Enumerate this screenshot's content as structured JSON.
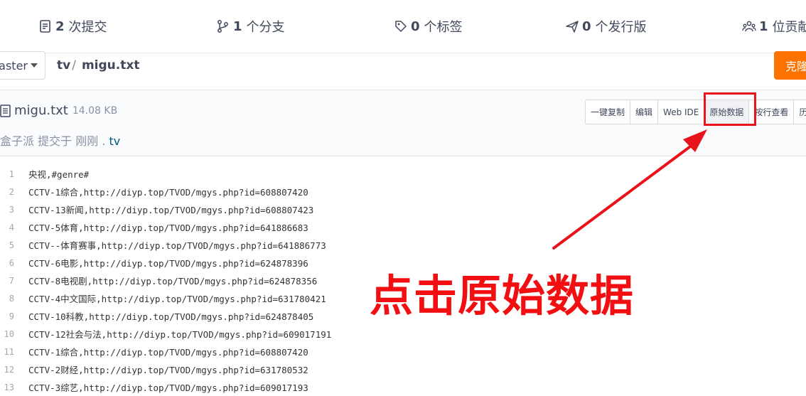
{
  "stats": {
    "commits": {
      "num": "2",
      "label": "次提交"
    },
    "branches": {
      "num": "1",
      "label": "个分支"
    },
    "tags": {
      "num": "0",
      "label": "个标签"
    },
    "releases": {
      "num": "0",
      "label": "个发行版"
    },
    "contributors": {
      "num": "1",
      "label": "位贡献"
    }
  },
  "branch": {
    "label": "aster"
  },
  "breadcrumb": {
    "folder": "tv",
    "sep": "/",
    "file": "migu.txt"
  },
  "clone_label": "克隆",
  "file": {
    "name": "migu.txt",
    "size": "14.08 KB"
  },
  "commit": {
    "author": "盒子派",
    "action": "提交于",
    "when": "刚刚",
    "dot": ".",
    "branch": "tv"
  },
  "tools": [
    "一键复制",
    "编辑",
    "Web IDE",
    "原始数据",
    "按行查看",
    "历"
  ],
  "code_lines": [
    {
      "n": "1",
      "t": "央视,#genre#"
    },
    {
      "n": "2",
      "t": "CCTV-1综合,http://diyp.top/TVOD/mgys.php?id=608807420"
    },
    {
      "n": "3",
      "t": "CCTV-13新闻,http://diyp.top/TVOD/mgys.php?id=608807423"
    },
    {
      "n": "4",
      "t": "CCTV-5体育,http://diyp.top/TVOD/mgys.php?id=641886683"
    },
    {
      "n": "5",
      "t": "CCTV--体育赛事,http://diyp.top/TVOD/mgys.php?id=641886773"
    },
    {
      "n": "6",
      "t": "CCTV-6电影,http://diyp.top/TVOD/mgys.php?id=624878396"
    },
    {
      "n": "7",
      "t": "CCTV-8电视剧,http://diyp.top/TVOD/mgys.php?id=624878356"
    },
    {
      "n": "8",
      "t": "CCTV-4中文国际,http://diyp.top/TVOD/mgys.php?id=631780421"
    },
    {
      "n": "9",
      "t": "CCTV-10科教,http://diyp.top/TVOD/mgys.php?id=624878405"
    },
    {
      "n": "10",
      "t": "CCTV-12社会与法,http://diyp.top/TVOD/mgys.php?id=609017191"
    },
    {
      "n": "11",
      "t": "CCTV-1综合,http://diyp.top/TVOD/mgys.php?id=608807420"
    },
    {
      "n": "12",
      "t": "CCTV-2财经,http://diyp.top/TVOD/mgys.php?id=631780532"
    },
    {
      "n": "13",
      "t": "CCTV-3综艺,http://diyp.top/TVOD/mgys.php?id=609017193"
    }
  ],
  "annotation": {
    "text": "点击原始数据",
    "color": "#f10f12"
  },
  "colors": {
    "accent": "#fe7300",
    "highlight": "#e8131b",
    "link": "#005980"
  }
}
